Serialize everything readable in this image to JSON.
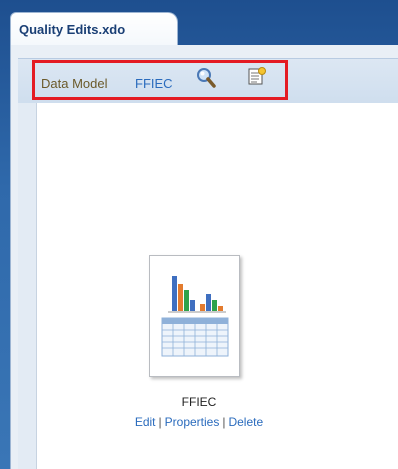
{
  "tab": {
    "title": "Quality Edits.xdo"
  },
  "toolbar": {
    "data_model_label": "Data Model",
    "data_model_value": "FFIEC",
    "search_icon": "search-icon",
    "properties_icon": "properties-icon",
    "highlight_color": "#e41b23"
  },
  "layout_item": {
    "name": "FFIEC",
    "actions": {
      "edit": "Edit",
      "properties": "Properties",
      "delete": "Delete",
      "separator": "|"
    }
  }
}
